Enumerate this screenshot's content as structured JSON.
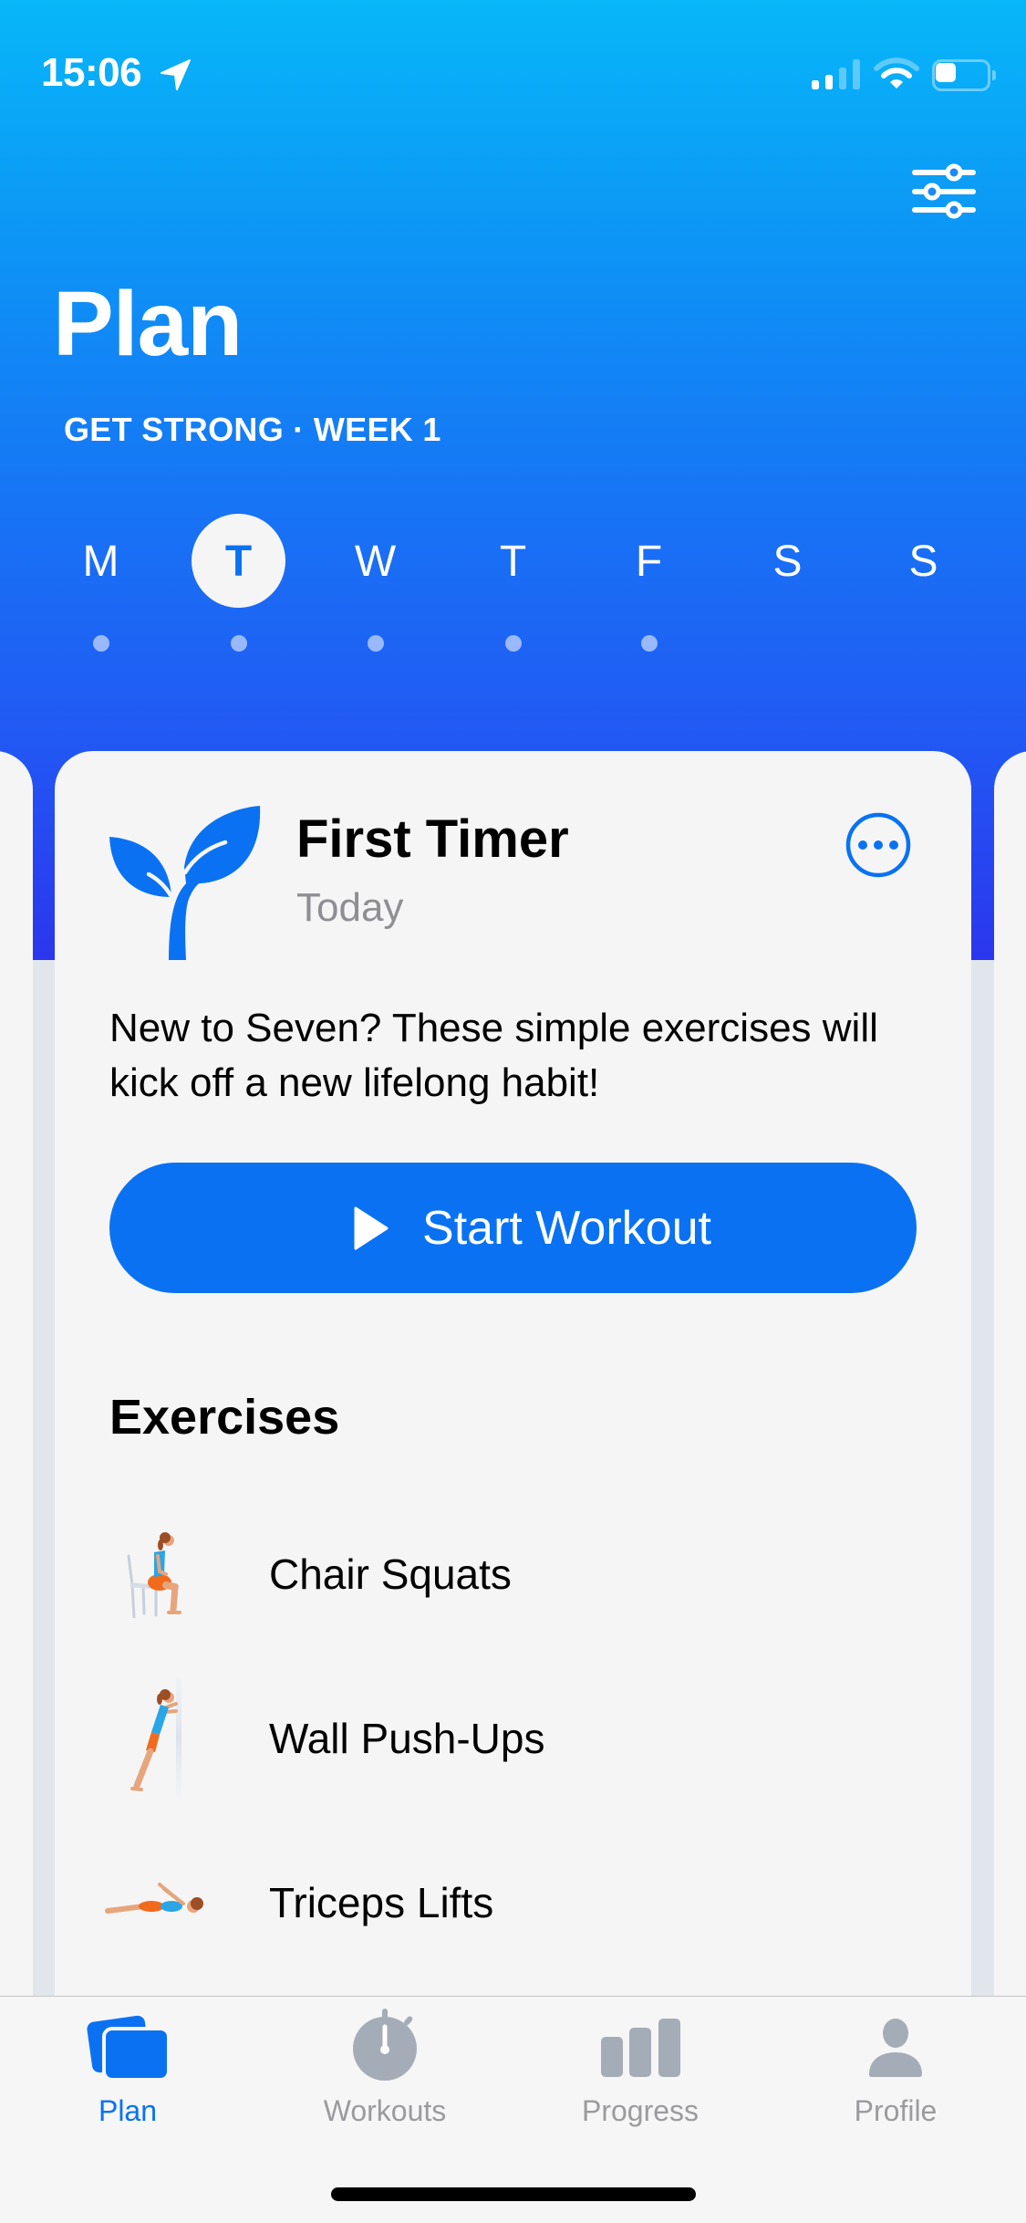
{
  "status_bar": {
    "time": "15:06",
    "location_icon": "location-arrow-icon",
    "signal": {
      "active_bars": 2,
      "total_bars": 4
    },
    "wifi": {
      "active_arcs": 2,
      "total_arcs": 3
    },
    "battery_level": 0.4
  },
  "header": {
    "filter_icon": "sliders-icon",
    "title": "Plan",
    "subtitle": "GET STRONG · WEEK 1"
  },
  "week": {
    "days": [
      {
        "label": "M",
        "selected": false,
        "has_workout": true
      },
      {
        "label": "T",
        "selected": true,
        "has_workout": true
      },
      {
        "label": "W",
        "selected": false,
        "has_workout": true
      },
      {
        "label": "T",
        "selected": false,
        "has_workout": true
      },
      {
        "label": "F",
        "selected": false,
        "has_workout": true
      },
      {
        "label": "S",
        "selected": false,
        "has_workout": false
      },
      {
        "label": "S",
        "selected": false,
        "has_workout": false
      }
    ]
  },
  "card": {
    "icon": "sprout-icon",
    "title": "First Timer",
    "date_label": "Today",
    "more_icon": "ellipsis-circle-icon",
    "description": "New to Seven? These simple exercises will kick off a new lifelong habit!",
    "start_button": {
      "icon": "play-icon",
      "label": "Start Workout"
    },
    "exercises_heading": "Exercises",
    "exercises": [
      {
        "name": "Chair Squats",
        "illustration": "chair-squat-figure"
      },
      {
        "name": "Wall Push-Ups",
        "illustration": "wall-push-up-figure"
      },
      {
        "name": "Triceps Lifts",
        "illustration": "triceps-lift-figure"
      }
    ]
  },
  "tab_bar": {
    "tabs": [
      {
        "label": "Plan",
        "icon": "cards-icon",
        "active": true
      },
      {
        "label": "Workouts",
        "icon": "stopwatch-icon",
        "active": false
      },
      {
        "label": "Progress",
        "icon": "bar-chart-icon",
        "active": false
      },
      {
        "label": "Profile",
        "icon": "person-icon",
        "active": false
      }
    ]
  },
  "colors": {
    "accent": "#0a72f2",
    "header_gradient_top": "#07b7f8",
    "header_gradient_bottom": "#2b36ee",
    "inactive_icon": "#a4acb7",
    "inactive_label": "#9b9b9f"
  }
}
